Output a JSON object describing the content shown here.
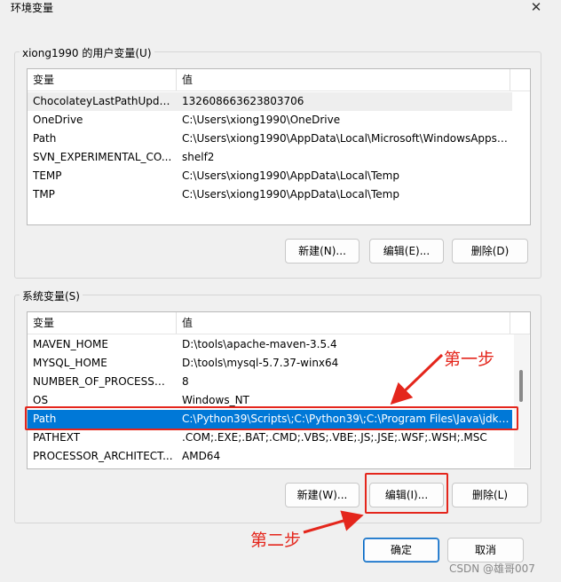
{
  "window": {
    "title": "环境变量",
    "close_glyph": "✕"
  },
  "user_vars": {
    "group_label": "xiong1990 的用户变量(U)",
    "col_variable": "变量",
    "col_value": "值",
    "rows": [
      {
        "name": "ChocolateyLastPathUpdate",
        "value": "132608663623803706"
      },
      {
        "name": "OneDrive",
        "value": "C:\\Users\\xiong1990\\OneDrive"
      },
      {
        "name": "Path",
        "value": "C:\\Users\\xiong1990\\AppData\\Local\\Microsoft\\WindowsApps;..."
      },
      {
        "name": "SVN_EXPERIMENTAL_CO...",
        "value": "shelf2"
      },
      {
        "name": "TEMP",
        "value": "C:\\Users\\xiong1990\\AppData\\Local\\Temp"
      },
      {
        "name": "TMP",
        "value": "C:\\Users\\xiong1990\\AppData\\Local\\Temp"
      }
    ],
    "buttons": {
      "new": "新建(N)...",
      "edit": "编辑(E)...",
      "delete": "删除(D)"
    }
  },
  "system_vars": {
    "group_label": "系统变量(S)",
    "col_variable": "变量",
    "col_value": "值",
    "rows": [
      {
        "name": "MAVEN_HOME",
        "value": "D:\\tools\\apache-maven-3.5.4"
      },
      {
        "name": "MYSQL_HOME",
        "value": "D:\\tools\\mysql-5.7.37-winx64"
      },
      {
        "name": "NUMBER_OF_PROCESSORS",
        "value": "8"
      },
      {
        "name": "OS",
        "value": "Windows_NT"
      },
      {
        "name": "Path",
        "value": "C:\\Python39\\Scripts\\;C:\\Python39\\;C:\\Program Files\\Java\\jdk1...."
      },
      {
        "name": "PATHEXT",
        "value": ".COM;.EXE;.BAT;.CMD;.VBS;.VBE;.JS;.JSE;.WSF;.WSH;.MSC"
      },
      {
        "name": "PROCESSOR_ARCHITECT...",
        "value": "AMD64"
      }
    ],
    "selected_row": "Path",
    "buttons": {
      "new": "新建(W)...",
      "edit": "编辑(I)...",
      "delete": "删除(L)"
    }
  },
  "footer": {
    "ok": "确定",
    "cancel": "取消"
  },
  "annotations": {
    "step1": "第一步",
    "step2": "第二步",
    "color": "#e4261c"
  },
  "watermark": "CSDN @雄哥007",
  "colors": {
    "selection": "#0078d7",
    "dialog_bg": "#f0f0f0"
  }
}
